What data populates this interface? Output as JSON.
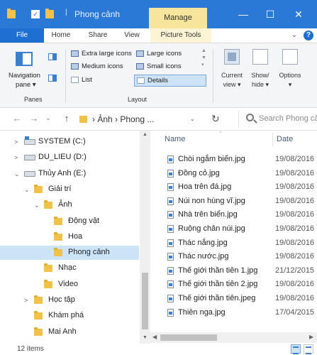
{
  "window": {
    "title": "Phong cảnh",
    "manage_tab": "Manage",
    "minimize": "—",
    "maximize": "☐",
    "close": "✕",
    "qa_divider": "|",
    "colors": {
      "titlebar": "#2b79d6",
      "manage": "#f8e59c",
      "file_tab": "#1e6fd1"
    }
  },
  "ribbon_tabs": {
    "file": "File",
    "home": "Home",
    "share": "Share",
    "view": "View",
    "picture_tools": "Picture Tools",
    "collapse": "⌄",
    "help": "?"
  },
  "ribbon": {
    "panes": {
      "navigation_pane": "Navigation",
      "navigation_pane_line2": "pane ▾",
      "group_label": "Panes"
    },
    "layout": {
      "extra_large_icons": "Extra large icons",
      "large_icons": "Large icons",
      "medium_icons": "Medium icons",
      "small_icons": "Small icons",
      "list": "List",
      "details": "Details",
      "group_label": "Layout",
      "scroll_arrows": "▲ ▼ ▾"
    },
    "current_view": {
      "line1": "Current",
      "line2": "view ▾"
    },
    "show_hide": {
      "line1": "Show/",
      "line2": "hide ▾"
    },
    "options": {
      "line1": "Options",
      "line2": "▾"
    }
  },
  "addressbar": {
    "back": "←",
    "forward": "→",
    "recent": "⌄",
    "up": "↑",
    "path": "› Ảnh › Phong ...",
    "dropdown": "⌄",
    "refresh": "↻",
    "search_placeholder": "Search Phong cảnh"
  },
  "nav_tree": [
    {
      "label": "SYSTEM (C:)",
      "chevron": ">",
      "kind": "drive-sys"
    },
    {
      "label": "DU_LIEU (D:)",
      "chevron": ">",
      "kind": "drive"
    },
    {
      "label": "Thủy Anh (E:)",
      "chevron": "⌄",
      "kind": "drive"
    },
    {
      "label": "Giải trí",
      "chevron": "⌄",
      "kind": "folder"
    },
    {
      "label": "Ảnh",
      "chevron": "⌄",
      "kind": "folder"
    },
    {
      "label": "Động vật",
      "chevron": "",
      "kind": "folder"
    },
    {
      "label": "Hoa",
      "chevron": "",
      "kind": "folder"
    },
    {
      "label": "Phong cảnh",
      "chevron": "",
      "kind": "folder",
      "selected": true
    },
    {
      "label": "Nhạc",
      "chevron": "",
      "kind": "folder"
    },
    {
      "label": "Video",
      "chevron": "",
      "kind": "folder"
    },
    {
      "label": "Học tập",
      "chevron": ">",
      "kind": "folder"
    },
    {
      "label": "Khám phá",
      "chevron": "",
      "kind": "folder"
    },
    {
      "label": "Mai Anh",
      "chevron": "",
      "kind": "folder"
    }
  ],
  "nav_scroll": {
    "up": "▲",
    "down": "▼"
  },
  "columns": {
    "name": "Name",
    "date": "Date",
    "sort_indicator": "⌃"
  },
  "files": [
    {
      "name": "Chòi ngắm biển.jpg",
      "date": "19/08/2016"
    },
    {
      "name": "Đồng cỏ.jpg",
      "date": "19/08/2016"
    },
    {
      "name": "Hoa trên đá.jpg",
      "date": "19/08/2016"
    },
    {
      "name": "Núi non hùng vĩ.jpg",
      "date": "19/08/2016"
    },
    {
      "name": "Nhà trên biển.jpg",
      "date": "19/08/2016"
    },
    {
      "name": "Ruộng chân núi.jpg",
      "date": "19/08/2016"
    },
    {
      "name": "Thác nắng.jpg",
      "date": "19/08/2016"
    },
    {
      "name": "Thác nước.jpg",
      "date": "19/08/2016"
    },
    {
      "name": "Thế giới thần tiên 1.jpg",
      "date": "21/12/2015"
    },
    {
      "name": "Thế giới thần tiên 2.jpg",
      "date": "19/08/2016"
    },
    {
      "name": "Thế giới thần tiên.jpeg",
      "date": "19/08/2016"
    },
    {
      "name": "Thiên nga.jpg",
      "date": "17/04/2015"
    }
  ],
  "hscroll": {
    "left": "◀",
    "right": "▶"
  },
  "status": {
    "count": "12 items"
  }
}
